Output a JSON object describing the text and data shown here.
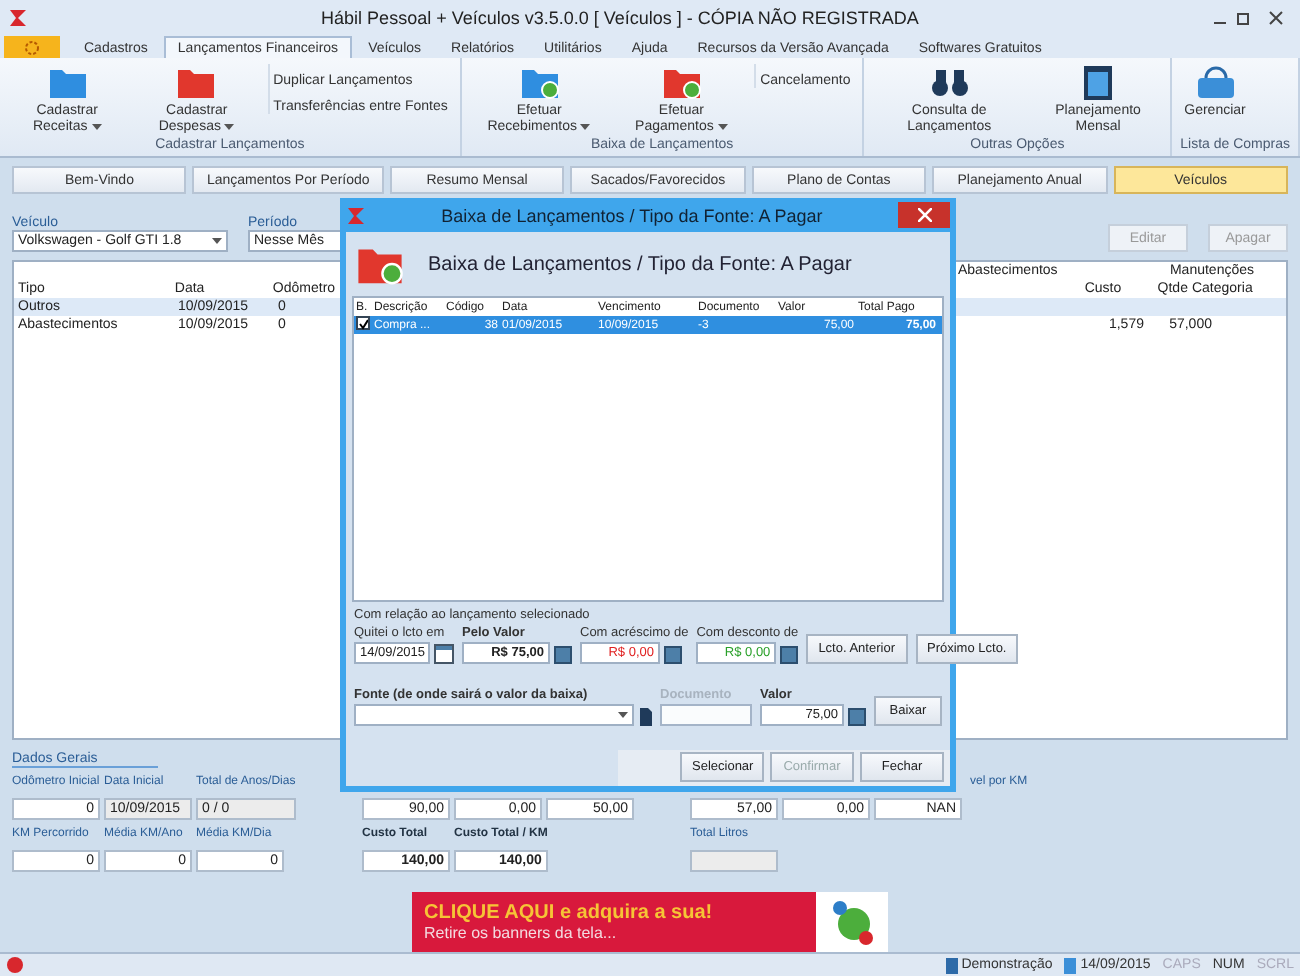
{
  "window": {
    "title": "Hábil Pessoal + Veículos v3.5.0.0 [ Veículos ] - CÓPIA NÃO REGISTRADA"
  },
  "ribbon": {
    "tabs": [
      {
        "label": "Cadastros",
        "selected": false
      },
      {
        "label": "Lançamentos Financeiros",
        "selected": true
      },
      {
        "label": "Veículos",
        "selected": false
      },
      {
        "label": "Relatórios",
        "selected": false
      },
      {
        "label": "Utilitários",
        "selected": false
      },
      {
        "label": "Ajuda",
        "selected": false
      },
      {
        "label": "Recursos da Versão Avançada",
        "selected": false
      },
      {
        "label": "Softwares Gratuitos",
        "selected": false
      }
    ],
    "groups": [
      {
        "title": "Cadastrar Lançamentos",
        "items": [
          {
            "kind": "large",
            "label": "Cadastrar Receitas",
            "dropdown": true
          },
          {
            "kind": "large",
            "label": "Cadastrar Despesas",
            "dropdown": true
          },
          {
            "kind": "small",
            "label": "Duplicar Lançamentos"
          },
          {
            "kind": "small",
            "label": "Transferências entre Fontes"
          }
        ]
      },
      {
        "title": "Baixa de Lançamentos",
        "items": [
          {
            "kind": "large",
            "label": "Efetuar Recebimentos",
            "dropdown": true
          },
          {
            "kind": "large",
            "label": "Efetuar Pagamentos",
            "dropdown": true
          },
          {
            "kind": "small",
            "label": "Cancelamento"
          }
        ]
      },
      {
        "title": "Outras Opções",
        "items": [
          {
            "kind": "large",
            "label": "Consulta de Lançamentos",
            "dropdown": false
          },
          {
            "kind": "large",
            "label": "Planejamento Mensal",
            "dropdown": false
          }
        ]
      },
      {
        "title": "Lista de Compras",
        "items": [
          {
            "kind": "large",
            "label": "Gerenciar",
            "dropdown": false
          }
        ]
      }
    ]
  },
  "nav_buttons": [
    {
      "label": "Bem-Vindo",
      "selected": false
    },
    {
      "label": "Lançamentos Por Período",
      "selected": false
    },
    {
      "label": "Resumo Mensal",
      "selected": false
    },
    {
      "label": "Sacados/Favorecidos",
      "selected": false
    },
    {
      "label": "Plano de Contas",
      "selected": false
    },
    {
      "label": "Planejamento Anual",
      "selected": false
    },
    {
      "label": "Veículos",
      "selected": true
    }
  ],
  "filters": {
    "vehicle": {
      "label": "Veículo",
      "value": "Volkswagen - Golf GTI 1.8"
    },
    "period": {
      "label": "Período",
      "value": "Nesse Mês"
    },
    "actions": [
      {
        "label": "Editar",
        "disabled": true
      },
      {
        "label": "Apagar",
        "disabled": true
      }
    ]
  },
  "table": {
    "group_headers": [
      "Abastecimentos",
      "Manutenções"
    ],
    "left_columns": [
      "Tipo",
      "Data",
      "Odômetro"
    ],
    "right_columns": [
      "Custo",
      "Qtde",
      "Categoria"
    ],
    "rows": [
      {
        "tipo": "Outros",
        "data": "10/09/2015",
        "odometro": "0",
        "selected": true
      },
      {
        "tipo": "Abastecimentos",
        "data": "10/09/2015",
        "odometro": "0",
        "custo": "1,579",
        "qtde": "57,000",
        "selected": false
      }
    ]
  },
  "dados_gerais": {
    "title": "Dados Gerais",
    "rows": [
      [
        [
          {
            "label": "Odômetro Inicial",
            "value": "0",
            "kind": "number"
          },
          {
            "label": "Data Inicial",
            "value": "10/09/2015",
            "kind": "readonly"
          },
          {
            "label": "Total de Anos/Dias",
            "value": "0 / 0",
            "kind": "readonly"
          }
        ],
        [
          {
            "value": "90,00",
            "kind": "number"
          },
          {
            "value": "0,00",
            "kind": "number"
          },
          {
            "value": "50,00",
            "kind": "number"
          }
        ],
        [
          {
            "value": "57,00",
            "kind": "number"
          },
          {
            "value": "0,00",
            "kind": "number"
          },
          {
            "label": "vel por KM",
            "value": "NAN",
            "kind": "number"
          }
        ]
      ],
      [
        [
          {
            "label": "KM Percorrido",
            "value": "0",
            "kind": "number"
          },
          {
            "label": "Média KM/Ano",
            "value": "0",
            "kind": "number"
          },
          {
            "label": "Média KM/Dia",
            "value": "0",
            "kind": "number"
          }
        ],
        [
          {
            "label": "Custo Total",
            "value": "140,00",
            "kind": "bold"
          },
          {
            "label": "Custo Total / KM",
            "value": "140,00",
            "kind": "bold"
          }
        ],
        [
          {
            "label": "Total Litros",
            "kind": "readonly"
          }
        ]
      ]
    ]
  },
  "banner": {
    "headline": "CLIQUE AQUI e adquira a sua!",
    "subline": "Retire os banners da tela..."
  },
  "status_bar": {
    "items": [
      {
        "kind": "user",
        "label": "Demonstração"
      },
      {
        "kind": "date",
        "label": "14/09/2015"
      },
      {
        "kind": "key",
        "label": "CAPS",
        "on": false
      },
      {
        "kind": "key",
        "label": "NUM",
        "on": true
      },
      {
        "kind": "key",
        "label": "SCRL",
        "on": false
      }
    ]
  },
  "dialog": {
    "title": "Baixa de Lançamentos / Tipo da Fonte: A Pagar",
    "heading": "Baixa de Lançamentos / Tipo da Fonte: A Pagar",
    "columns": [
      "B.",
      "Descrição",
      "Código",
      "Data",
      "Vencimento",
      "Documento",
      "Valor",
      "Total Pago"
    ],
    "rows": [
      {
        "checked": true,
        "selected": true,
        "cells": [
          "",
          "Compra ...",
          "38",
          "01/09/2015",
          "10/09/2015",
          "-3",
          "75,00",
          "75,00"
        ]
      }
    ],
    "caption": "Com relação ao lançamento selecionado",
    "paid_on": {
      "label": "Quitei o lcto em",
      "value": "14/09/2015"
    },
    "by_value": {
      "label": "Pelo Valor",
      "value": "R$ 75,00"
    },
    "surcharge": {
      "label": "Com acréscimo de",
      "value": "R$ 0,00"
    },
    "discount": {
      "label": "Com desconto de",
      "value": "R$ 0,00"
    },
    "nav": [
      "Lcto. Anterior",
      "Próximo Lcto."
    ],
    "source": {
      "label": "Fonte (de onde sairá o valor da baixa)"
    },
    "document": {
      "label": "Documento",
      "disabled": true
    },
    "amount": {
      "label": "Valor",
      "value": "75,00"
    },
    "settle": "Baixar",
    "footer": [
      {
        "label": "Selecionar",
        "disabled": false
      },
      {
        "label": "Confirmar",
        "disabled": true
      },
      {
        "label": "Fechar",
        "disabled": false
      }
    ]
  }
}
